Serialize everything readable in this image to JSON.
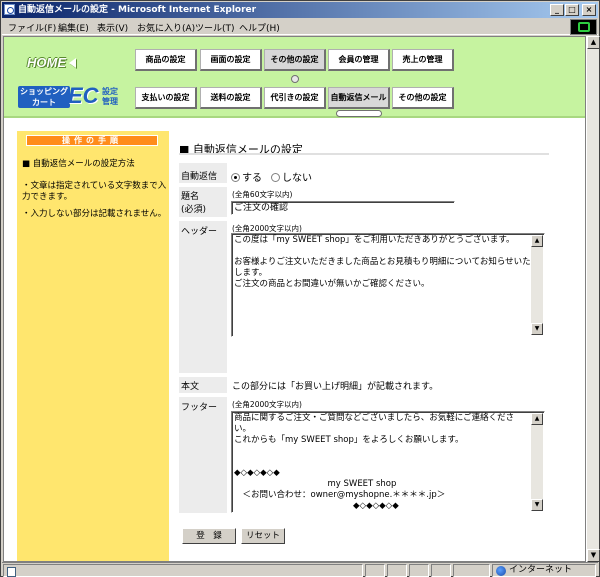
{
  "window": {
    "title": "自動返信メールの設定 - Microsoft Internet Explorer",
    "min_glyph": "_",
    "max_glyph": "□",
    "close_glyph": "×"
  },
  "menu": [
    "ファイル(F)",
    "編集(E)",
    "表示(V)",
    "お気に入り(A)",
    "ツール(T)",
    "ヘルプ(H)"
  ],
  "header": {
    "home_label": "HOME",
    "logo_shop_line1": "ショッピング",
    "logo_shop_line2": "カート",
    "logo_ec": "EC",
    "logo_kanri_line1": "設定",
    "logo_kanri_line2": "管理",
    "nav_top": [
      "商品の設定",
      "画面の設定",
      "その他の設定",
      "会員の管理",
      "売上の管理"
    ],
    "nav_bottom": [
      "支払いの設定",
      "送料の設定",
      "代引きの設定",
      "自動返信メール",
      "その他の設定"
    ]
  },
  "sidebar": {
    "heading": "操作の手順",
    "item1": "■ 自動返信メールの設定方法",
    "item2": "・文章は指定されている文字数まで入力できます。",
    "item3": "・入力しない部分は記載されません。"
  },
  "form": {
    "title": "■ 自動返信メールの設定",
    "auto_reply_label": "自動返信",
    "radio_on": "する",
    "radio_off": "しない",
    "subject_label": "題名",
    "subject_required": "(必須)",
    "subject_note": "(全角60文字以内)",
    "subject_value": "ご注文の確認",
    "header_label": "ヘッダー",
    "header_note": "(全角2000文字以内)",
    "header_text": "この度は「my SWEET shop」をご利用いただきありがとうございます。\n\nお客様よりご注文いただきました商品とお見積もり明細についてお知らせいたします。\nご注文の商品とお間違いが無いかご確認ください。",
    "body_label": "本文",
    "body_note": "この部分には「お買い上げ明細」が記載されます。",
    "footer_label": "フッター",
    "footer_note": "(全角2000文字以内)",
    "footer_text": "商品に関するご注文・ご質問などございましたら、お気軽にご連絡ください。\nこれからも「my SWEET shop」をよろしくお願いします。\n\n\n◆◇◆◇◆◇◆\n　　　　　　　　　　　my SWEET shop\n　＜お問い合わせ：owner@myshopne.＊＊＊＊.jp＞\n　　　　　　　　　　　　　　◆◇◆◇◆◇◆",
    "register_label": "登　録",
    "reset_label": "リセット"
  },
  "status": {
    "zone": "インターネット"
  }
}
